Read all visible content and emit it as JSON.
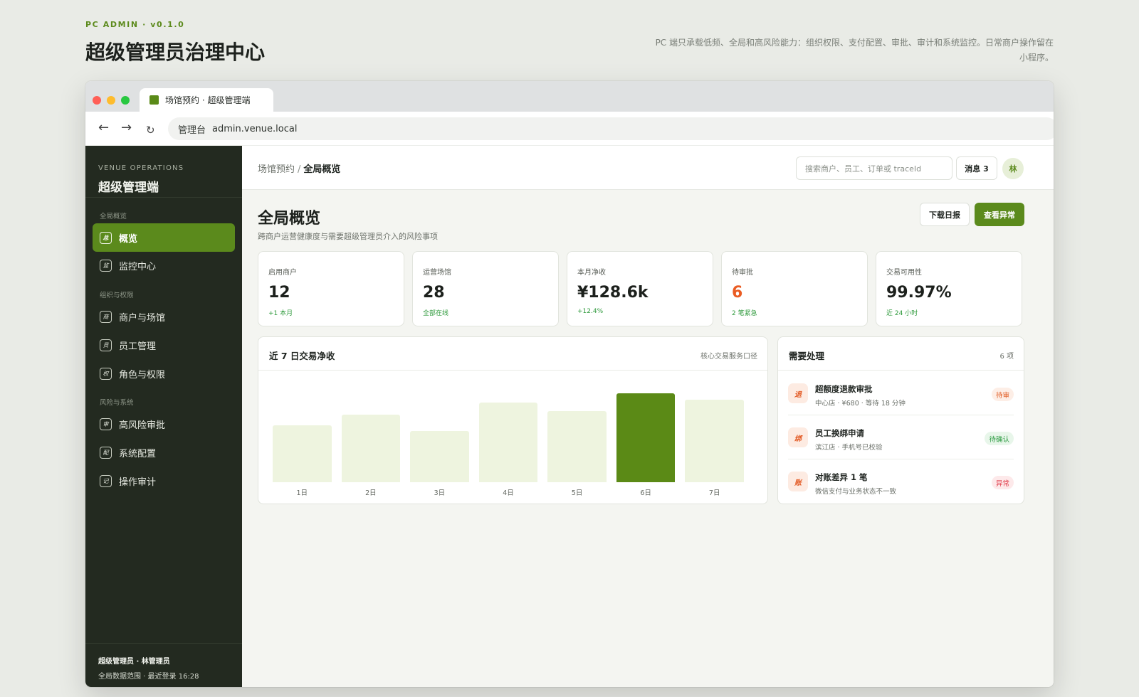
{
  "page": {
    "kicker": "PC ADMIN · v0.1.0",
    "title": "超级管理员治理中心",
    "description": "PC 端只承载低频、全局和高风险能力：组织权限、支付配置、审批、审计和系统监控。日常商户操作留在小程序。"
  },
  "browser": {
    "tab_title": "场馆预约 · 超级管理端",
    "url_prefix": "管理台",
    "url": "admin.venue.local",
    "back": "←",
    "forward": "→",
    "reload": "↻"
  },
  "sidebar": {
    "kicker": "VENUE OPERATIONS",
    "title": "超级管理端",
    "groups": [
      "全局概览",
      "组织与权限",
      "风险与系统"
    ],
    "items": [
      {
        "label": "概览",
        "icon": "总"
      },
      {
        "label": "监控中心",
        "icon": "监"
      },
      {
        "label": "商户与场馆",
        "icon": "商"
      },
      {
        "label": "员工管理",
        "icon": "员"
      },
      {
        "label": "角色与权限",
        "icon": "权"
      },
      {
        "label": "高风险审批",
        "icon": "审"
      },
      {
        "label": "系统配置",
        "icon": "配"
      },
      {
        "label": "操作审计",
        "icon": "记"
      }
    ],
    "footer_user": "超级管理员 · 林管理员",
    "footer_meta": "全局数据范围 · 最近登录 16:28"
  },
  "topbar": {
    "crumb_parent": "场馆预约",
    "crumb_sep": "/",
    "crumb_current": "全局概览",
    "search_placeholder": "搜索商户、员工、订单或 traceId",
    "messages": "消息 3",
    "avatar": "林"
  },
  "overview": {
    "title": "全局概览",
    "subtitle": "跨商户运营健康度与需要超级管理员介入的风险事项",
    "btn_download": "下载日报",
    "btn_anomaly": "查看异常"
  },
  "stats": [
    {
      "label": "启用商户",
      "value": "12",
      "note": "+1 本月"
    },
    {
      "label": "运营场馆",
      "value": "28",
      "note": "全部在线"
    },
    {
      "label": "本月净收",
      "value": "¥128.6k",
      "note": "+12.4%"
    },
    {
      "label": "待审批",
      "value": "6",
      "note": "2 笔紧急"
    },
    {
      "label": "交易可用性",
      "value": "99.97%",
      "note": "近 24 小时"
    }
  ],
  "chart_panel": {
    "title": "近 7 日交易净收",
    "aux": "核心交易服务口径"
  },
  "chart_data": {
    "type": "bar",
    "categories": [
      "1日",
      "2日",
      "3日",
      "4日",
      "5日",
      "6日",
      "7日"
    ],
    "values": [
      64,
      76,
      58,
      90,
      80,
      100,
      93
    ],
    "highlight_index": 5,
    "colors": {
      "normal": "#eef4df",
      "highlight": "#5b8a16"
    }
  },
  "todo_panel": {
    "title": "需要处理",
    "count": "6 项",
    "items": [
      {
        "icon": "退",
        "title": "超额度退款审批",
        "sub": "中心店 · ¥680 · 等待 18 分钟",
        "badge": "待审",
        "tone": "orange"
      },
      {
        "icon": "绑",
        "title": "员工换绑申请",
        "sub": "滨江店 · 手机号已校验",
        "badge": "待确认",
        "tone": "green"
      },
      {
        "icon": "账",
        "title": "对账差异 1 笔",
        "sub": "微信支付与业务状态不一致",
        "badge": "异常",
        "tone": "red"
      }
    ]
  },
  "colors": {
    "accent": "#5b8a1c",
    "sidebar_bg": "#232a20",
    "warn": "#ea5c23",
    "positive": "#2f9a3c"
  }
}
